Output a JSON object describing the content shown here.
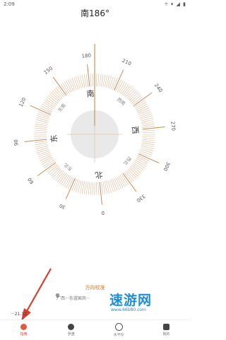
{
  "status": {
    "time": "2:09",
    "icons": "⌾ ▾ ◢ ▮"
  },
  "heading": "南186°",
  "compass": {
    "degree_labels": [
      "0",
      "30",
      "60",
      "90",
      "120",
      "150",
      "180",
      "210",
      "240",
      "270",
      "300",
      "330"
    ],
    "directions": {
      "north": "北",
      "east": "东",
      "south": "南",
      "west": "西"
    },
    "intercardinals": {
      "northeast": "东北",
      "southeast": "东南",
      "southwest": "西南",
      "northwest": "西北"
    },
    "heading_deg": 186
  },
  "calibration_label": "方向校准",
  "coords_text": "广西···东道国风···",
  "coord_bottom": "···21.12",
  "nav": [
    {
      "label": "指南",
      "active": true
    },
    {
      "label": "罗盘",
      "active": false
    },
    {
      "label": "水平仪",
      "active": false
    },
    {
      "label": "我的",
      "active": false
    }
  ],
  "watermark": {
    "text": "速游网",
    "sub": "www.66b80.com"
  },
  "colors": {
    "tick": "#d9a37a",
    "needle": "#c87a3c",
    "active": "#d6402f",
    "watermark": "#1f8ed6"
  }
}
